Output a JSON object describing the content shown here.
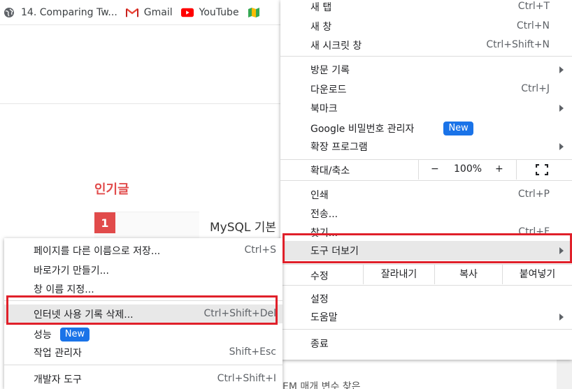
{
  "bookmarks": [
    {
      "icon": "globe-icon",
      "label": "14. Comparing Tw..."
    },
    {
      "icon": "gmail-icon",
      "label": "Gmail"
    },
    {
      "icon": "youtube-icon",
      "label": "YouTube"
    },
    {
      "icon": "maps-icon",
      "label": ""
    }
  ],
  "page": {
    "popular_heading": "인기글",
    "rank_number": "1",
    "post_title": "MySQL 기본 -",
    "bottom_snippet": "EM 매개 변수 찾은"
  },
  "main_menu": {
    "new_tab": {
      "label": "새 탭",
      "shortcut": "Ctrl+T"
    },
    "new_window": {
      "label": "새 창",
      "shortcut": "Ctrl+N"
    },
    "incognito": {
      "label": "새 시크릿 창",
      "shortcut": "Ctrl+Shift+N"
    },
    "history": {
      "label": "방문 기록"
    },
    "downloads": {
      "label": "다운로드",
      "shortcut": "Ctrl+J"
    },
    "bookmarks": {
      "label": "북마크"
    },
    "passwords": {
      "label": "Google 비밀번호 관리자",
      "badge": "New"
    },
    "extensions": {
      "label": "확장 프로그램"
    },
    "zoom": {
      "label": "확대/축소",
      "minus": "−",
      "value": "100%",
      "plus": "+",
      "fullscreen_icon": "fullscreen-icon"
    },
    "print": {
      "label": "인쇄",
      "shortcut": "Ctrl+P"
    },
    "cast": {
      "label": "전송..."
    },
    "find": {
      "label": "찾기...",
      "shortcut": "Ctrl+F"
    },
    "more_tools": {
      "label": "도구 더보기"
    },
    "edit": {
      "label": "수정",
      "cut": "잘라내기",
      "copy": "복사",
      "paste": "붙여넣기"
    },
    "settings": {
      "label": "설정"
    },
    "help": {
      "label": "도움말"
    },
    "exit": {
      "label": "종료"
    }
  },
  "sub_menu": {
    "save_page": {
      "label": "페이지를 다른 이름으로 저장...",
      "shortcut": "Ctrl+S"
    },
    "create_shortcut": {
      "label": "바로가기 만들기..."
    },
    "name_window": {
      "label": "창 이름 지정..."
    },
    "clear_data": {
      "label": "인터넷 사용 기록 삭제...",
      "shortcut": "Ctrl+Shift+Del"
    },
    "performance": {
      "label": "성능",
      "badge": "New"
    },
    "task_manager": {
      "label": "작업 관리자",
      "shortcut": "Shift+Esc"
    },
    "dev_tools": {
      "label": "개발자 도구",
      "shortcut": "Ctrl+Shift+I"
    }
  },
  "colors": {
    "highlight_border": "#e0202a",
    "new_badge": "#1a73e8",
    "accent_red": "#e14b4b"
  }
}
